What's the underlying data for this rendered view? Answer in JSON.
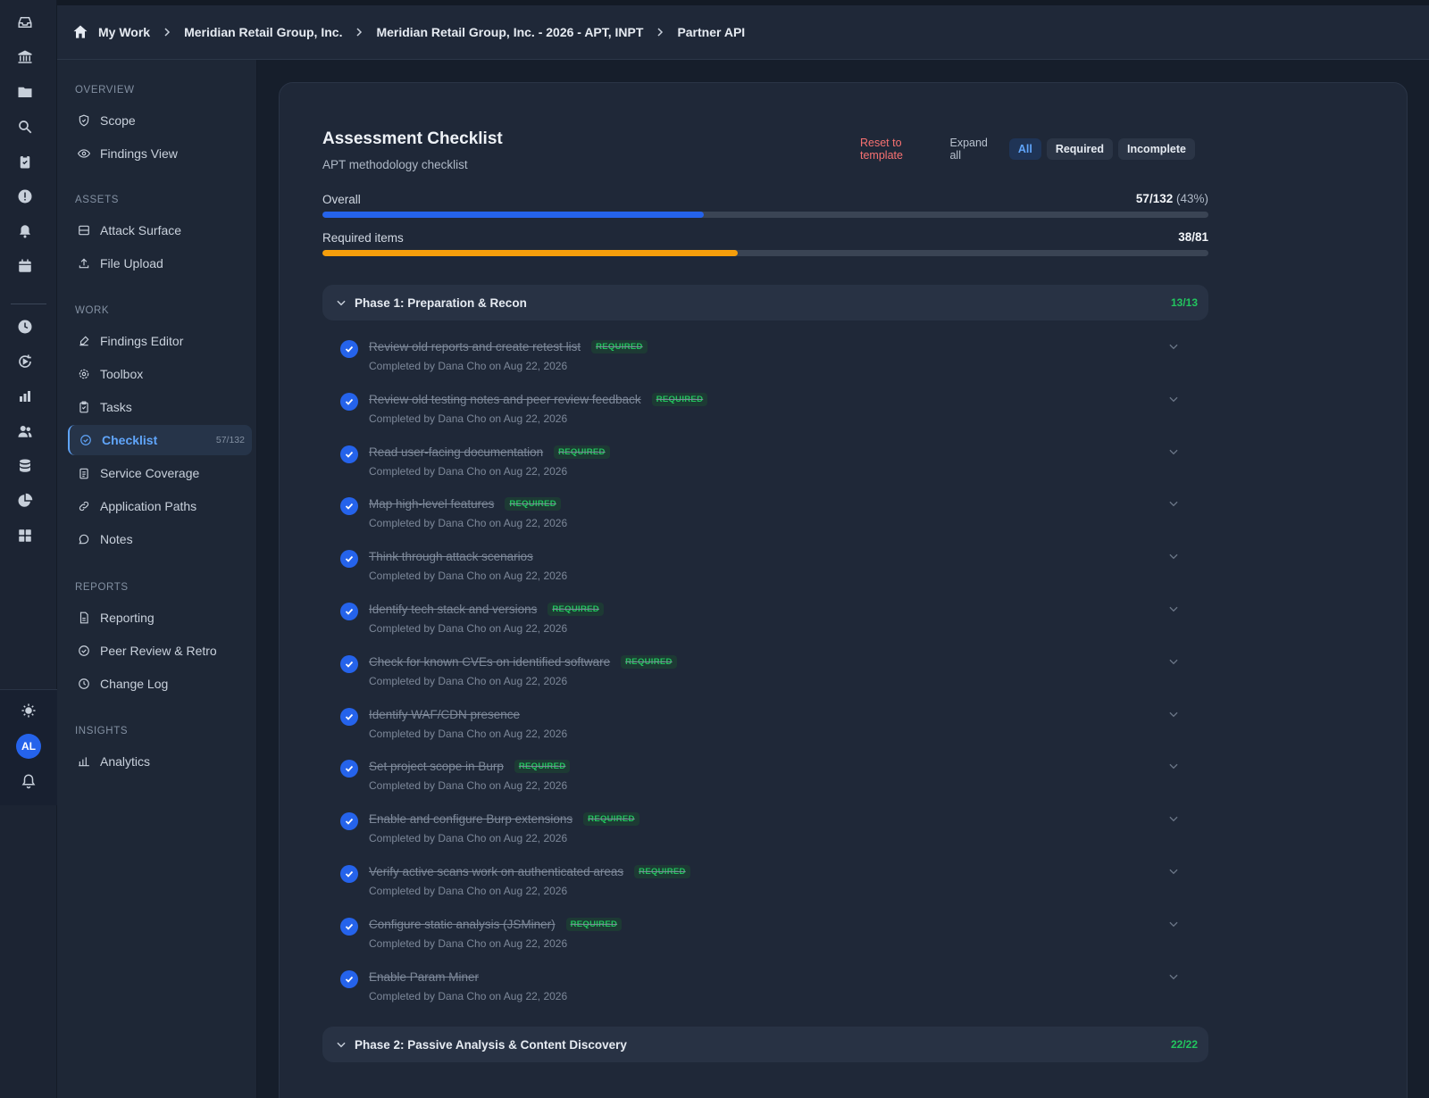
{
  "breadcrumb": {
    "items": [
      "My Work",
      "Meridian Retail Group, Inc.",
      "Meridian Retail Group, Inc. - 2026 - APT, INPT",
      "Partner API"
    ]
  },
  "rail": {
    "icons": [
      "inbox-icon",
      "bank-icon",
      "folder-icon",
      "search-icon",
      "clipboard-icon",
      "alert-icon",
      "bell-icon",
      "calendar-icon",
      "clock-icon",
      "refresh-icon",
      "bar-chart-icon",
      "users-icon",
      "database-icon",
      "pie-chart-icon",
      "grid-icon"
    ],
    "bottom_icons": [
      "sun-icon",
      "bell-outline-icon"
    ],
    "avatar_initials": "AL"
  },
  "sidebar": {
    "sections": [
      {
        "title": "OVERVIEW",
        "items": [
          {
            "label": "Scope",
            "icon": "shield-icon"
          },
          {
            "label": "Findings View",
            "icon": "eye-icon"
          }
        ]
      },
      {
        "title": "ASSETS",
        "items": [
          {
            "label": "Attack Surface",
            "icon": "server-icon"
          },
          {
            "label": "File Upload",
            "icon": "upload-icon"
          }
        ]
      },
      {
        "title": "WORK",
        "items": [
          {
            "label": "Findings Editor",
            "icon": "edit-icon"
          },
          {
            "label": "Toolbox",
            "icon": "gear-icon"
          },
          {
            "label": "Tasks",
            "icon": "clipboard-icon"
          },
          {
            "label": "Checklist",
            "icon": "check-circle-icon",
            "count": "57/132",
            "active": true
          },
          {
            "label": "Service Coverage",
            "icon": "clipboard-list-icon"
          },
          {
            "label": "Application Paths",
            "icon": "link-icon"
          },
          {
            "label": "Notes",
            "icon": "chat-icon"
          }
        ]
      },
      {
        "title": "REPORTS",
        "items": [
          {
            "label": "Reporting",
            "icon": "file-icon"
          },
          {
            "label": "Peer Review & Retro",
            "icon": "check-circle-icon"
          },
          {
            "label": "Change Log",
            "icon": "clock-icon"
          }
        ]
      },
      {
        "title": "INSIGHTS",
        "items": [
          {
            "label": "Analytics",
            "icon": "bar-chart-icon"
          }
        ]
      }
    ]
  },
  "checklist": {
    "title": "Assessment Checklist",
    "subtitle": "APT methodology checklist",
    "reset_label": "Reset to template",
    "expand_label": "Expand all",
    "filters": [
      "All",
      "Required",
      "Incomplete"
    ],
    "active_filter": "All",
    "overall": {
      "label": "Overall",
      "value": "57/132",
      "pct": "(43%)",
      "fraction": 0.43
    },
    "required": {
      "label": "Required items",
      "value": "38/81",
      "fraction": 0.469
    },
    "colors": {
      "overall_bar": "#2563eb",
      "required_bar": "#f59e0b",
      "required_badge": "#22c55e"
    },
    "required_badge": "REQUIRED",
    "phases": [
      {
        "name": "Phase 1: Preparation & Recon",
        "count": "13/13",
        "items": [
          {
            "text": "Review old reports and create retest list",
            "required": true,
            "meta": "Completed by Dana Cho on Aug 22, 2026"
          },
          {
            "text": "Review old testing notes and peer review feedback",
            "required": true,
            "meta": "Completed by Dana Cho on Aug 22, 2026"
          },
          {
            "text": "Read user-facing documentation",
            "required": true,
            "meta": "Completed by Dana Cho on Aug 22, 2026"
          },
          {
            "text": "Map high-level features",
            "required": true,
            "meta": "Completed by Dana Cho on Aug 22, 2026"
          },
          {
            "text": "Think through attack scenarios",
            "required": false,
            "meta": "Completed by Dana Cho on Aug 22, 2026"
          },
          {
            "text": "Identify tech stack and versions",
            "required": true,
            "meta": "Completed by Dana Cho on Aug 22, 2026"
          },
          {
            "text": "Check for known CVEs on identified software",
            "required": true,
            "meta": "Completed by Dana Cho on Aug 22, 2026"
          },
          {
            "text": "Identify WAF/CDN presence",
            "required": false,
            "meta": "Completed by Dana Cho on Aug 22, 2026"
          },
          {
            "text": "Set project scope in Burp",
            "required": true,
            "meta": "Completed by Dana Cho on Aug 22, 2026"
          },
          {
            "text": "Enable and configure Burp extensions",
            "required": true,
            "meta": "Completed by Dana Cho on Aug 22, 2026"
          },
          {
            "text": "Verify active scans work on authenticated areas",
            "required": true,
            "meta": "Completed by Dana Cho on Aug 22, 2026"
          },
          {
            "text": "Configure static analysis (JSMiner)",
            "required": true,
            "meta": "Completed by Dana Cho on Aug 22, 2026"
          },
          {
            "text": "Enable Param Miner",
            "required": false,
            "meta": "Completed by Dana Cho on Aug 22, 2026"
          }
        ]
      },
      {
        "name": "Phase 2: Passive Analysis & Content Discovery",
        "count": "22/22",
        "items": []
      }
    ]
  }
}
